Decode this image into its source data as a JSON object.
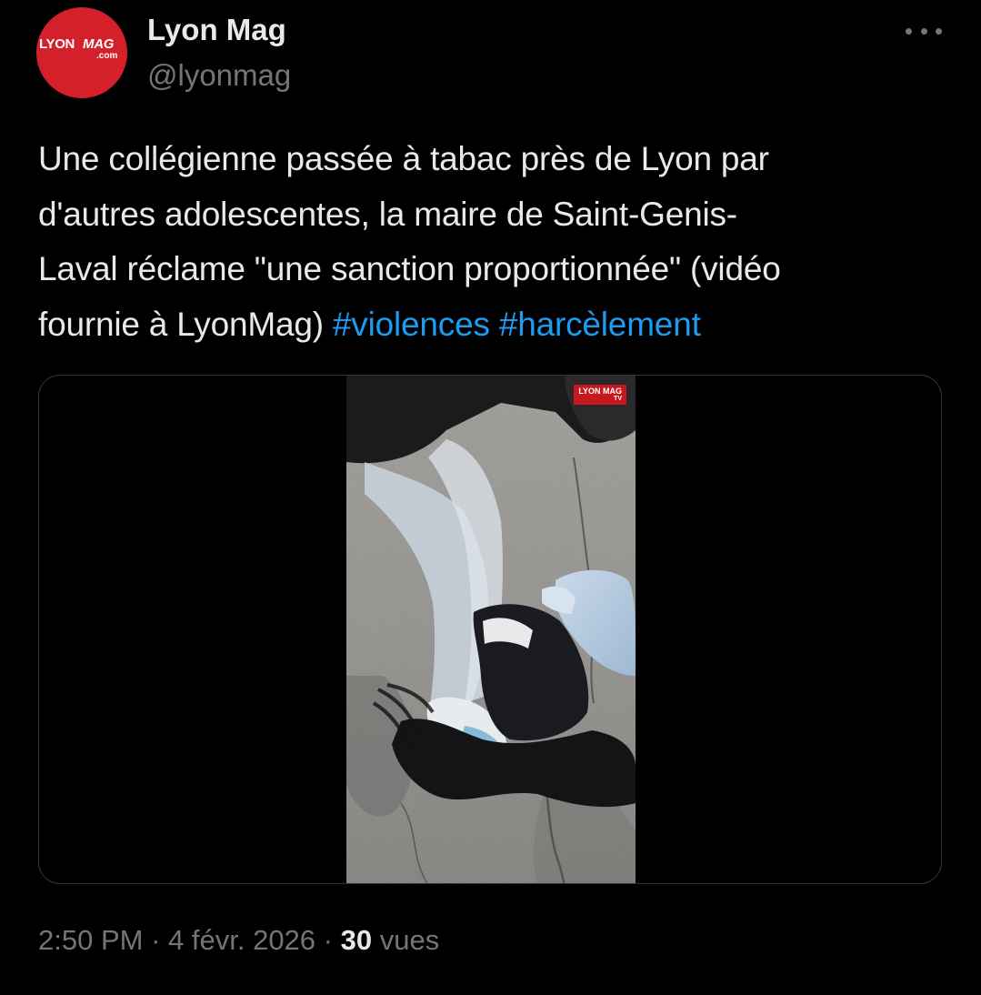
{
  "author": {
    "display_name": "Lyon Mag",
    "handle": "@lyonmag",
    "avatar_logo": {
      "word1": "LYON",
      "word2": "MAG",
      "suffix": ".com",
      "color": "#d3202a"
    }
  },
  "menu": {
    "more_icon": "more-horizontal-icon"
  },
  "tweet": {
    "text_lines": [
      "Une collégienne passée à tabac près de Lyon par",
      "d'autres adolescentes, la maire de Saint-Genis-",
      "Laval réclame \"une sanction proportionnée\" (vidéo",
      "fournie à LyonMag)"
    ],
    "hashtags": [
      "#violences",
      "#harcèlement"
    ],
    "hashtag_color": "#1d9bf0"
  },
  "media": {
    "type": "video",
    "watermark": {
      "text": "LYON MAG",
      "sub": "TV"
    }
  },
  "meta": {
    "time": "2:50 PM",
    "separator": "·",
    "date": "4 févr. 2026",
    "views_count": "30",
    "views_label": "vues"
  },
  "colors": {
    "background": "#000000",
    "text_primary": "#e7e9ea",
    "text_secondary": "#71767b",
    "border": "#333639"
  }
}
